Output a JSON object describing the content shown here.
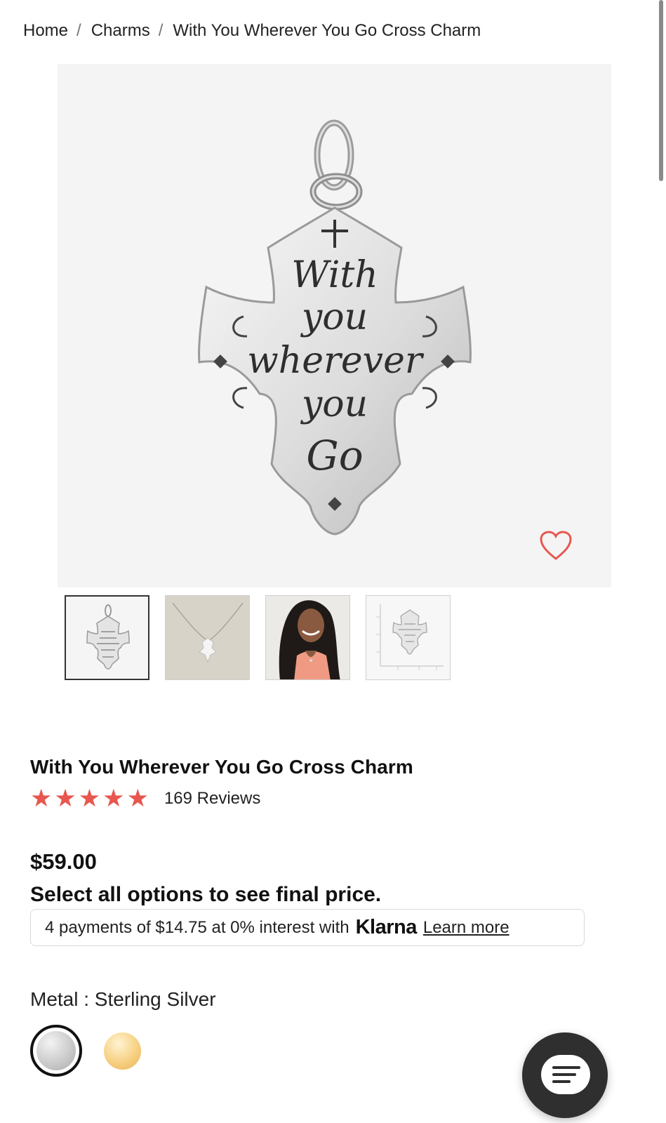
{
  "breadcrumb": {
    "items": [
      "Home",
      "Charms",
      "With You Wherever You Go Cross Charm"
    ],
    "separator": "/"
  },
  "product": {
    "engraving": [
      "With",
      "you",
      "wherever",
      "you",
      "Go"
    ],
    "title": "With You Wherever You Go Cross Charm",
    "rating": 5,
    "reviews": "169 Reviews",
    "price": "$59.00",
    "price_note": "Select all options to see final price."
  },
  "klarna": {
    "text": "4 payments of $14.75 at 0% interest with",
    "brand": "Klarna",
    "learn_more": "Learn more"
  },
  "metal": {
    "label": "Metal : Sterling Silver",
    "options": [
      "Sterling Silver",
      "Gold"
    ],
    "selected": "Sterling Silver"
  },
  "icons": {
    "wishlist": "heart-icon",
    "chat": "chat-icon",
    "star": "star-icon"
  },
  "colors": {
    "accent": "#e8574f",
    "chat_bg": "#2f2f2f",
    "gold": "#f6cd7c"
  }
}
